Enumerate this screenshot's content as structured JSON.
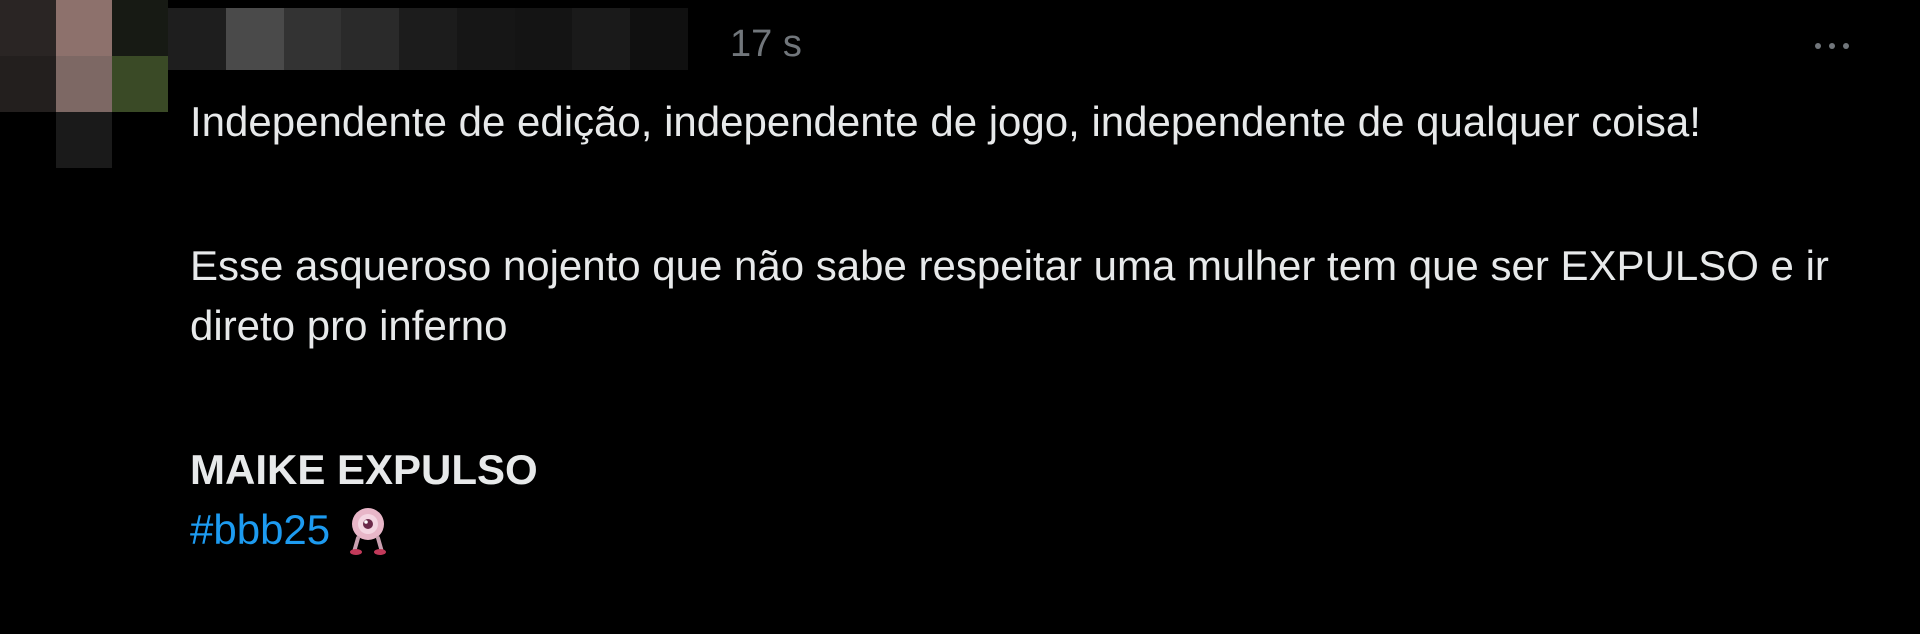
{
  "tweet": {
    "timestamp": "17 s",
    "paragraphs": [
      "Independente de edição, independente de jogo, independente de qualquer coisa!",
      "Esse asqueroso nojento que não sabe respeitar uma mulher tem que ser EXPULSO e ir direto pro inferno"
    ],
    "bold_line": "MAIKE EXPULSO",
    "hashtag": "#bbb25",
    "more_icon": "more-horizontal-icon",
    "hashflag_icon": "bbb-eye-hashflag-icon"
  },
  "colors": {
    "background": "#000000",
    "text": "#e7e9ea",
    "secondary_text": "#71767b",
    "link": "#1d9bf0"
  }
}
